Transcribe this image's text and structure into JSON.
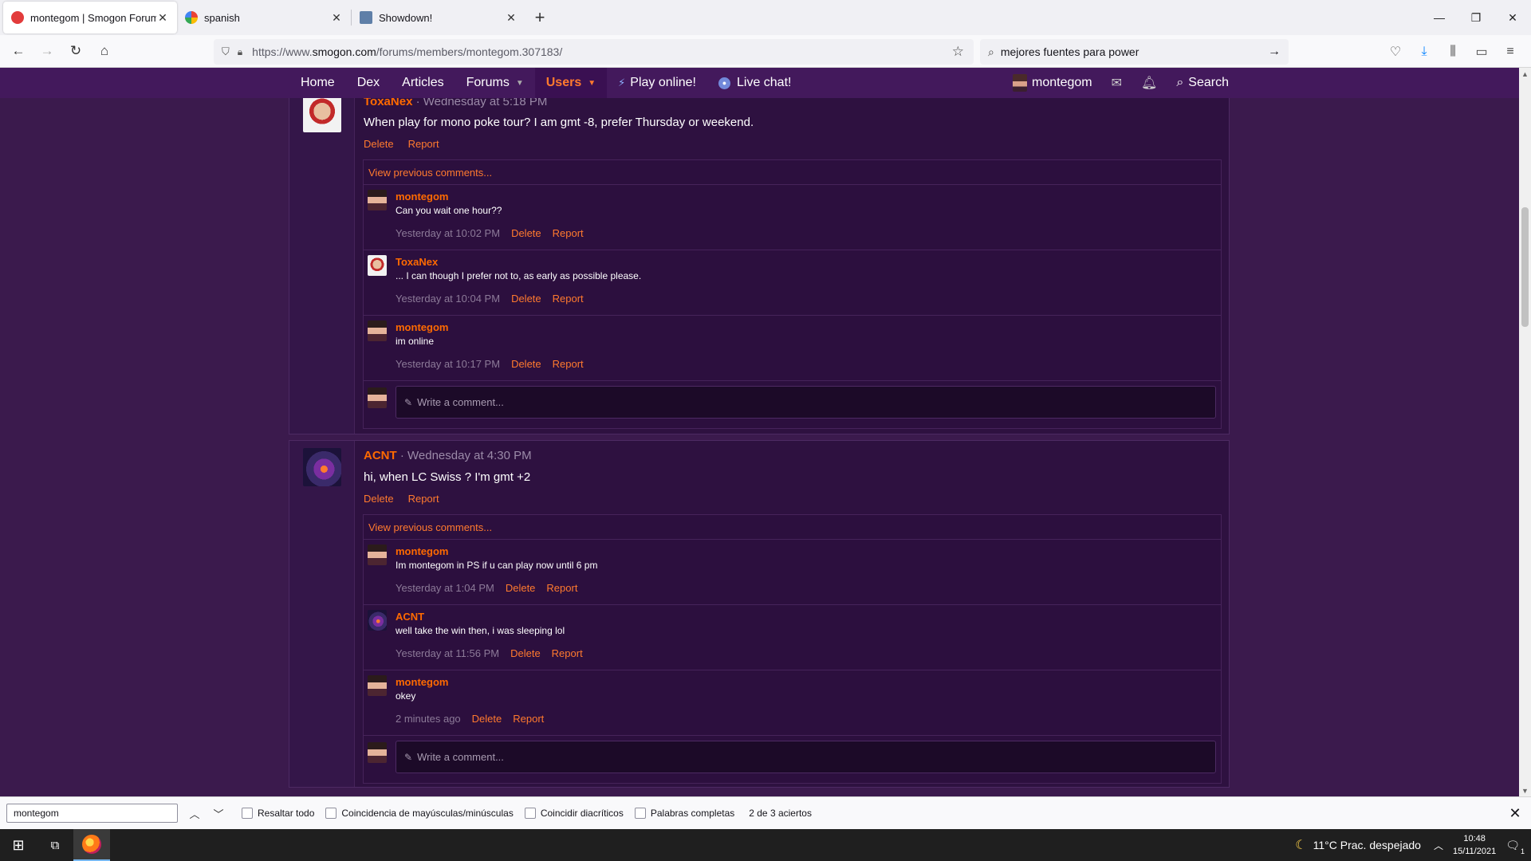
{
  "browser": {
    "tabs": [
      {
        "title": "montegom | Smogon Forums",
        "active": true
      },
      {
        "title": "spanish",
        "active": false
      },
      {
        "title": "Showdown!",
        "active": false
      }
    ],
    "url_prefix": "https://www.",
    "url_domain": "smogon.com",
    "url_path": "/forums/members/montegom.307183/",
    "search_query": "mejores fuentes para power"
  },
  "site_nav": {
    "items": [
      "Home",
      "Dex",
      "Articles",
      "Forums",
      "Users",
      "Play online!",
      "Live chat!"
    ],
    "username": "montegom",
    "search_label": "Search"
  },
  "posts": [
    {
      "author": "ToxaNex",
      "time": "Wednesday at 5:18 PM",
      "body": "When play for mono poke tour? I am gmt -8, prefer Thursday or weekend.",
      "actions": [
        "Delete",
        "Report"
      ],
      "view_previous": "View previous comments...",
      "comments": [
        {
          "author": "montegom",
          "text": "Can you wait one hour??",
          "time": "Yesterday at 10:02 PM"
        },
        {
          "author": "ToxaNex",
          "text": "... I can though I prefer not to, as early as possible please.",
          "time": "Yesterday at 10:04 PM"
        },
        {
          "author": "montegom",
          "text": "im online",
          "time": "Yesterday at 10:17 PM"
        }
      ],
      "write_placeholder": "Write a comment..."
    },
    {
      "author": "ACNT",
      "time": "Wednesday at 4:30 PM",
      "body": "hi, when LC Swiss ? I'm gmt +2",
      "actions": [
        "Delete",
        "Report"
      ],
      "view_previous": "View previous comments...",
      "comments": [
        {
          "author": "montegom",
          "text": "Im montegom in PS if u can play now until 6 pm",
          "time": "Yesterday at 1:04 PM"
        },
        {
          "author": "ACNT",
          "text": "well take the win then, i was sleeping lol",
          "time": "Yesterday at 11:56 PM"
        },
        {
          "author": "montegom",
          "text": "okey",
          "time": "2 minutes ago"
        }
      ],
      "write_placeholder": "Write a comment..."
    }
  ],
  "comment_actions": [
    "Delete",
    "Report"
  ],
  "findbar": {
    "query": "montegom",
    "options": [
      "Resaltar todo",
      "Coincidencia de mayúsculas/minúsculas",
      "Coincidir diacríticos",
      "Palabras completas"
    ],
    "result": "2 de 3 aciertos"
  },
  "taskbar": {
    "weather": "11°C  Prac. despejado",
    "time": "10:48",
    "date": "15/11/2021",
    "notifications": "1"
  },
  "colors": {
    "page_bg": "#3b1a4d",
    "header_bg": "#43195c",
    "accent": "#ff6a00"
  }
}
